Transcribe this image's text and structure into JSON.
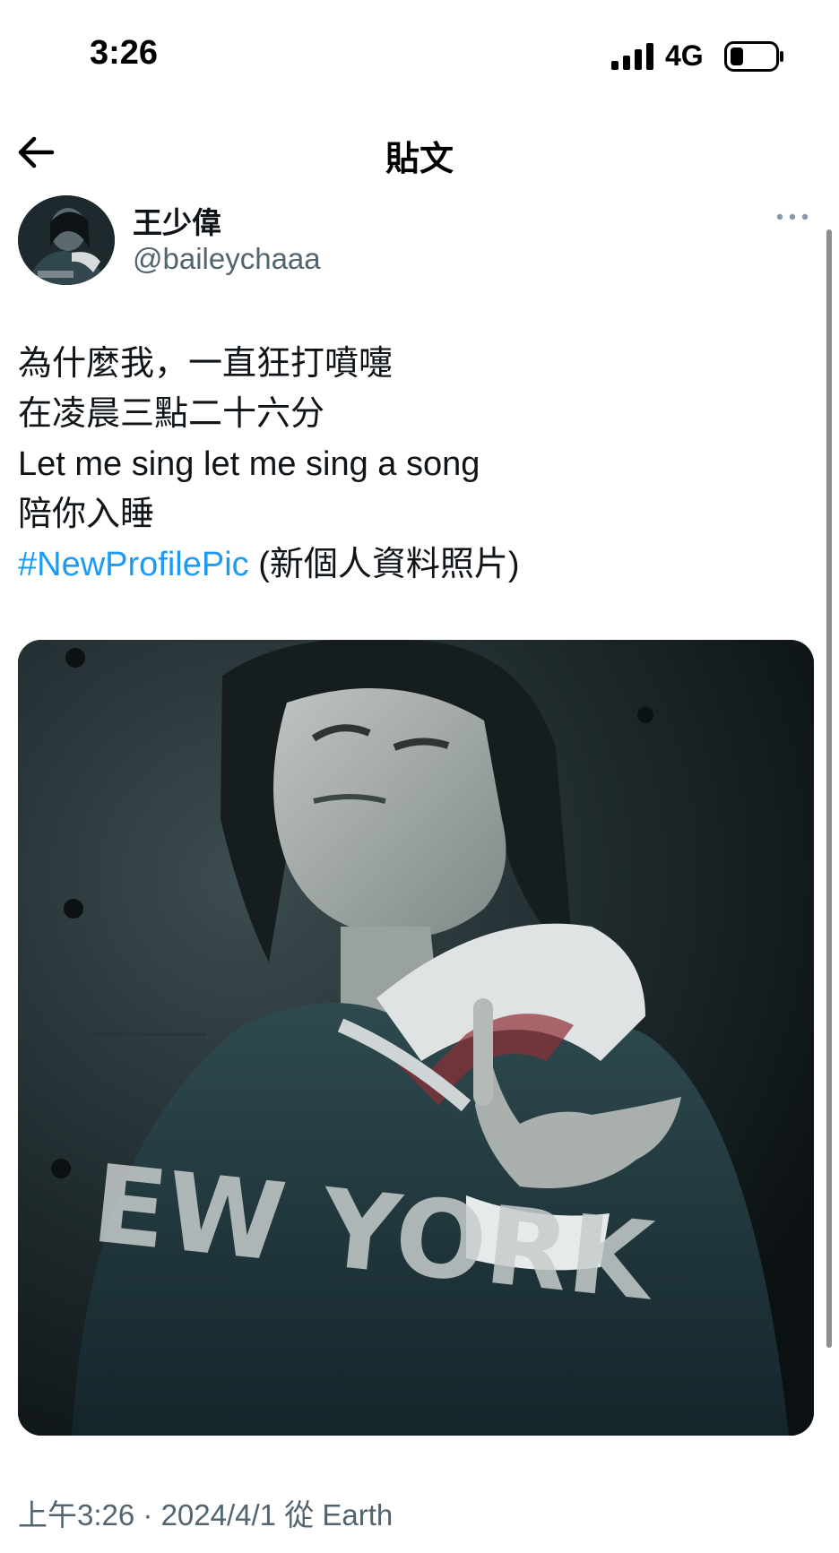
{
  "status_bar": {
    "time": "3:26",
    "network": "4G",
    "signal_icon": "cellular-signal-icon",
    "battery_icon": "battery-low-icon"
  },
  "header": {
    "back_icon": "arrow-left-icon",
    "title": "貼文"
  },
  "post": {
    "author": {
      "name": "王少偉",
      "handle": "@baileychaaa",
      "avatar": "profile-photo"
    },
    "more_icon": "more-horizontal-icon",
    "lines": [
      "為什麼我，一直狂打噴嚏",
      "在凌晨三點二十六分",
      "Let me sing let me sing a song",
      "陪你入睡"
    ],
    "hashtag": "#NewProfilePic",
    "hashtag_translation": "(新個人資料照片)",
    "image_text": "EW YORK",
    "time_label": "上午3:26",
    "separator": "·",
    "date": "2024/4/1",
    "source_prefix": "從",
    "source": "Earth"
  },
  "colors": {
    "link": "#1d9bf0",
    "secondary_text": "#536471",
    "primary_text": "#0f1419"
  }
}
